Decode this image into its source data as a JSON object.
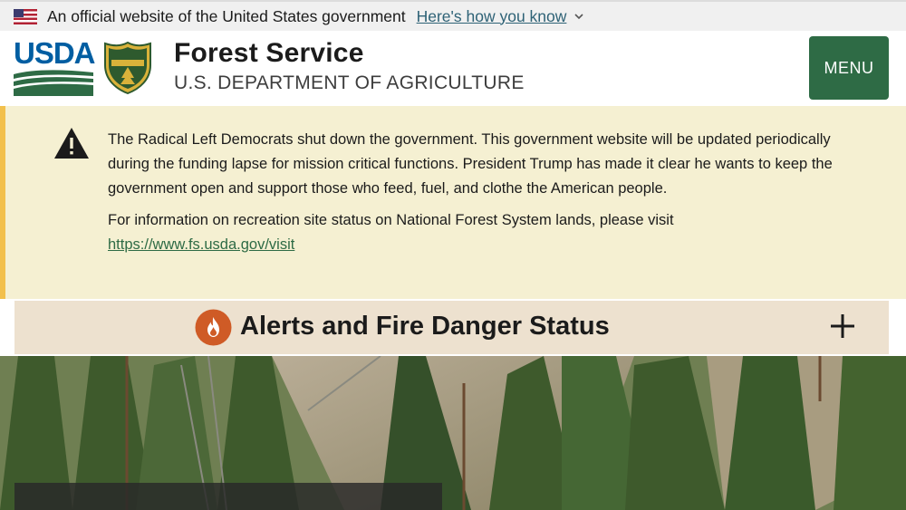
{
  "gov_banner": {
    "text": "An official website of the United States government",
    "link": "Here's how you know"
  },
  "header": {
    "usda_logo_text": "USDA",
    "title": "Forest Service",
    "subtitle": "U.S. DEPARTMENT OF AGRICULTURE",
    "menu_label": "MENU"
  },
  "alert": {
    "paragraph1": "The Radical Left Democrats shut down the government. This government website will be updated periodically during the funding lapse for mission critical functions. President Trump has made it clear he wants to keep the government open and support those who feed, fuel, and clothe the American people.",
    "paragraph2_text": "For information on recreation site status on National Forest System lands, please visit",
    "paragraph2_link": "https://www.fs.usda.gov/visit"
  },
  "fire_status": {
    "title": "Alerts and Fire Danger Status"
  },
  "colors": {
    "menu_bg": "#2e6b45",
    "alert_bg": "#f5f0d2",
    "alert_border": "#f2c04c",
    "fire_bar_bg": "#ede1cf",
    "fire_icon": "#cf5b26",
    "link": "#2e6b45"
  },
  "icons": {
    "flag": "us-flag-icon",
    "chevron": "chevron-down-icon",
    "shield": "forest-service-shield-icon",
    "warning": "warning-triangle-icon",
    "fire": "fire-icon",
    "expand": "plus-icon"
  }
}
